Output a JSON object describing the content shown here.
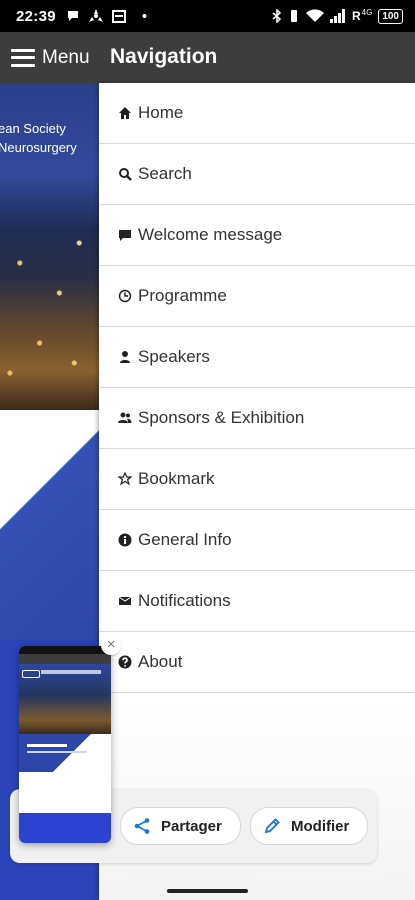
{
  "status_bar": {
    "time": "22:39",
    "left_icons": [
      "chat-bubble-icon",
      "fan-icon",
      "calendar-icon",
      "dot-icon"
    ],
    "right_icons": [
      "bluetooth-icon",
      "vibrate-icon",
      "wifi-icon",
      "signal-icon"
    ],
    "signal_label": "R",
    "network_label": "4G",
    "battery": "100"
  },
  "header": {
    "menu_label": "Menu",
    "title": "Navigation"
  },
  "background_app": {
    "text_line1": "ean Society",
    "text_line2": "Neurosurgery"
  },
  "nav": {
    "items": [
      {
        "label": "Home",
        "icon": "home-icon"
      },
      {
        "label": "Search",
        "icon": "search-icon"
      },
      {
        "label": "Welcome message",
        "icon": "message-icon"
      },
      {
        "label": "Programme",
        "icon": "clock-icon"
      },
      {
        "label": "Speakers",
        "icon": "person-icon"
      },
      {
        "label": "Sponsors & Exhibition",
        "icon": "group-icon"
      },
      {
        "label": "Bookmark",
        "icon": "star-icon"
      },
      {
        "label": "General Info",
        "icon": "info-icon"
      },
      {
        "label": "Notifications",
        "icon": "envelope-icon"
      },
      {
        "label": "About",
        "icon": "question-icon"
      }
    ]
  },
  "share_sheet": {
    "share_label": "Partager",
    "edit_label": "Modifier",
    "close_symbol": "×"
  },
  "colors": {
    "header_bg": "#3d3d3d",
    "brand_blue": "#2c47a8",
    "chip_icon_blue": "#1a73e8"
  }
}
